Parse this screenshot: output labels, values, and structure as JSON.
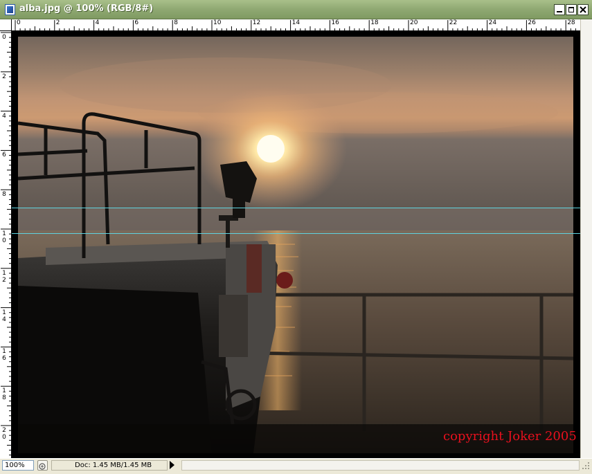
{
  "window": {
    "title": "alba.jpg @ 100% (RGB/8#)",
    "icon": "photoshop-document-icon",
    "buttons": {
      "minimize": "minimize-icon",
      "maximize": "maximize-icon",
      "close": "close-icon"
    }
  },
  "rulers": {
    "top_labels": [
      "0",
      "2",
      "4",
      "6",
      "8",
      "10",
      "12",
      "14",
      "16",
      "18",
      "20",
      "22",
      "24",
      "26",
      "28"
    ],
    "left_labels": [
      [
        "0"
      ],
      [
        "2"
      ],
      [
        "4"
      ],
      [
        "6"
      ],
      [
        "8"
      ],
      [
        "1",
        "0"
      ],
      [
        "1",
        "2"
      ],
      [
        "1",
        "4"
      ],
      [
        "1",
        "6"
      ],
      [
        "1",
        "8"
      ],
      [
        "2",
        "0"
      ]
    ]
  },
  "canvas": {
    "copyright": "copyright Joker 2005",
    "guide_color": "#5fd4e0",
    "copyright_color": "#e8101e"
  },
  "statusbar": {
    "zoom": "100%",
    "doc_info": "Doc: 1.45 MB/1.45 MB"
  }
}
